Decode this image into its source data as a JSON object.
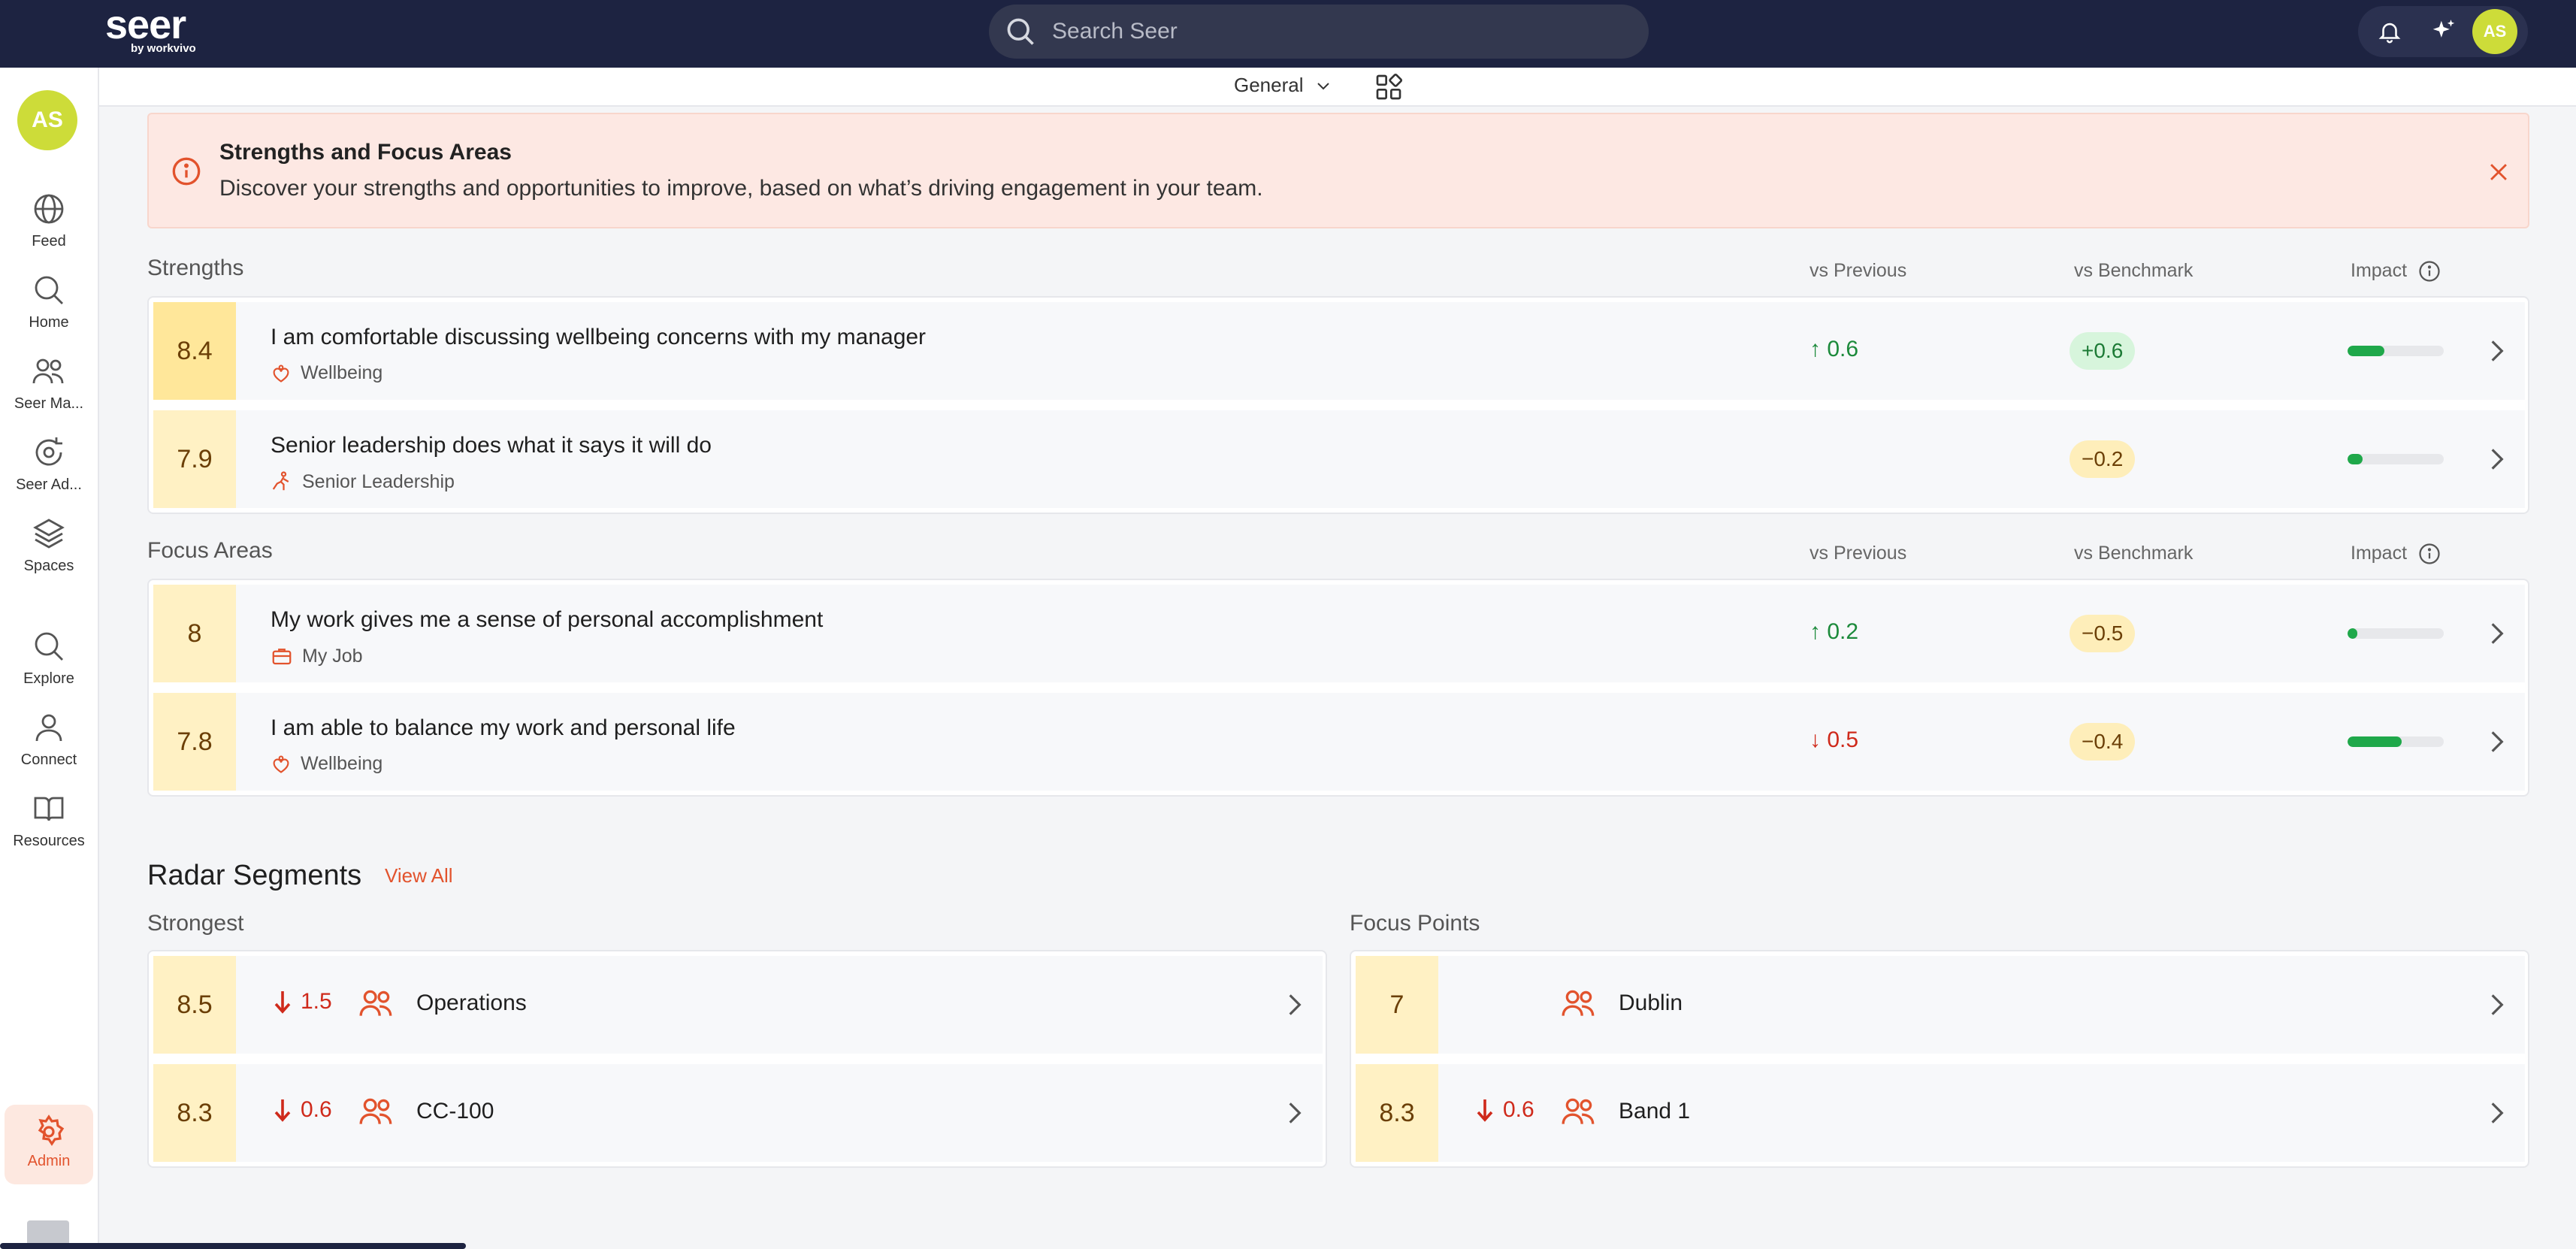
{
  "header": {
    "logo_word": "seer",
    "logo_sub": "by workvivo",
    "search_placeholder": "Search Seer",
    "avatar": "AS"
  },
  "sidebar": {
    "avatar": "AS",
    "items": [
      {
        "label": "Feed",
        "icon": "globe-icon"
      },
      {
        "label": "Home",
        "icon": "search-icon"
      },
      {
        "label": "Seer Ma...",
        "icon": "people-icon"
      },
      {
        "label": "Seer Ad...",
        "icon": "refresh-icon"
      },
      {
        "label": "Spaces",
        "icon": "layers-icon"
      },
      {
        "label": "Explore",
        "icon": "search-icon"
      },
      {
        "label": "Connect",
        "icon": "person-icon"
      },
      {
        "label": "Resources",
        "icon": "book-icon"
      }
    ],
    "admin": {
      "label": "Admin",
      "icon": "gear-icon"
    }
  },
  "subbar": {
    "dropdown": "General"
  },
  "banner": {
    "title": "Strengths and Focus Areas",
    "text": "Discover your strengths and opportunities to improve, based on what’s driving engagement in your team."
  },
  "columns": {
    "prev": "vs Previous",
    "bench": "vs Benchmark",
    "impact": "Impact"
  },
  "strengths": {
    "label": "Strengths",
    "rows": [
      {
        "score": "8.4",
        "title": "I am comfortable discussing wellbeing concerns with my manager",
        "category": "Wellbeing",
        "prev": "0.6",
        "prev_dir": "up",
        "bench": "+0.6",
        "bench_dir": "pos",
        "impact": 0.38
      },
      {
        "score": "7.9",
        "title": "Senior leadership does what it says it will do",
        "category": "Senior Leadership",
        "prev": "",
        "prev_dir": "",
        "bench": "−0.2",
        "bench_dir": "neg",
        "impact": 0.16
      }
    ]
  },
  "focus": {
    "label": "Focus Areas",
    "rows": [
      {
        "score": "8",
        "title": "My work gives me a sense of personal accomplishment",
        "category": "My Job",
        "prev": "0.2",
        "prev_dir": "up",
        "bench": "−0.5",
        "bench_dir": "neg",
        "impact": 0.1
      },
      {
        "score": "7.8",
        "title": "I am able to balance my work and personal life",
        "category": "Wellbeing",
        "prev": "0.5",
        "prev_dir": "down",
        "bench": "−0.4",
        "bench_dir": "neg",
        "impact": 0.56
      }
    ]
  },
  "radar": {
    "title": "Radar Segments",
    "view_all": "View All",
    "strongest": {
      "label": "Strongest",
      "rows": [
        {
          "score": "8.5",
          "delta": "1.5",
          "name": "Operations"
        },
        {
          "score": "8.3",
          "delta": "0.6",
          "name": "CC-100"
        }
      ]
    },
    "focus_points": {
      "label": "Focus Points",
      "rows": [
        {
          "score": "7",
          "delta": "",
          "name": "Dublin"
        },
        {
          "score": "8.3",
          "delta": "0.6",
          "name": "Band 1"
        }
      ]
    }
  },
  "colors": {
    "accent": "#e2532d",
    "topbar": "#1d2341",
    "avatar": "#cddc39",
    "impact": "#1fa84a"
  }
}
